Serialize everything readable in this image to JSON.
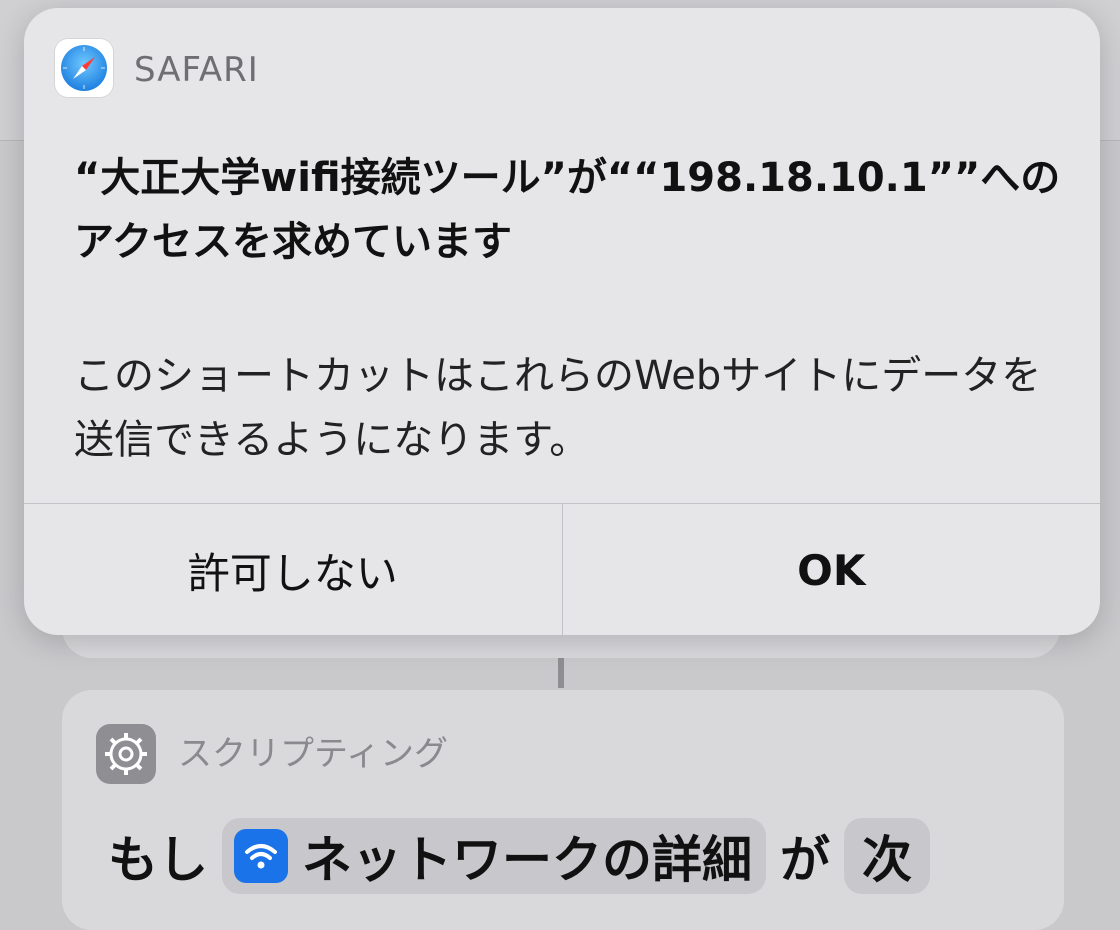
{
  "alert": {
    "app_name": "SAFARI",
    "app_icon": "safari-compass-icon",
    "title": "“大正大学wifi接続ツール”が““198.18.10.1””へのアクセスを求めています",
    "message": "このショートカットはこれらのWebサイトにデータを送信できるようになります。",
    "deny_label": "許可しない",
    "ok_label": "OK"
  },
  "background": {
    "category_label": "スクリプティング",
    "category_icon": "gear-icon",
    "action": {
      "prefix": "もし",
      "token_icon": "wifi-icon",
      "token_label": "ネットワークの詳細",
      "connector": "が",
      "next_label": "次"
    }
  },
  "colors": {
    "alert_bg": "#e6e6e9",
    "backdrop": "#c9c9cc",
    "wifi_blue": "#1a73e8",
    "safari_blue": "#1e88e5"
  }
}
